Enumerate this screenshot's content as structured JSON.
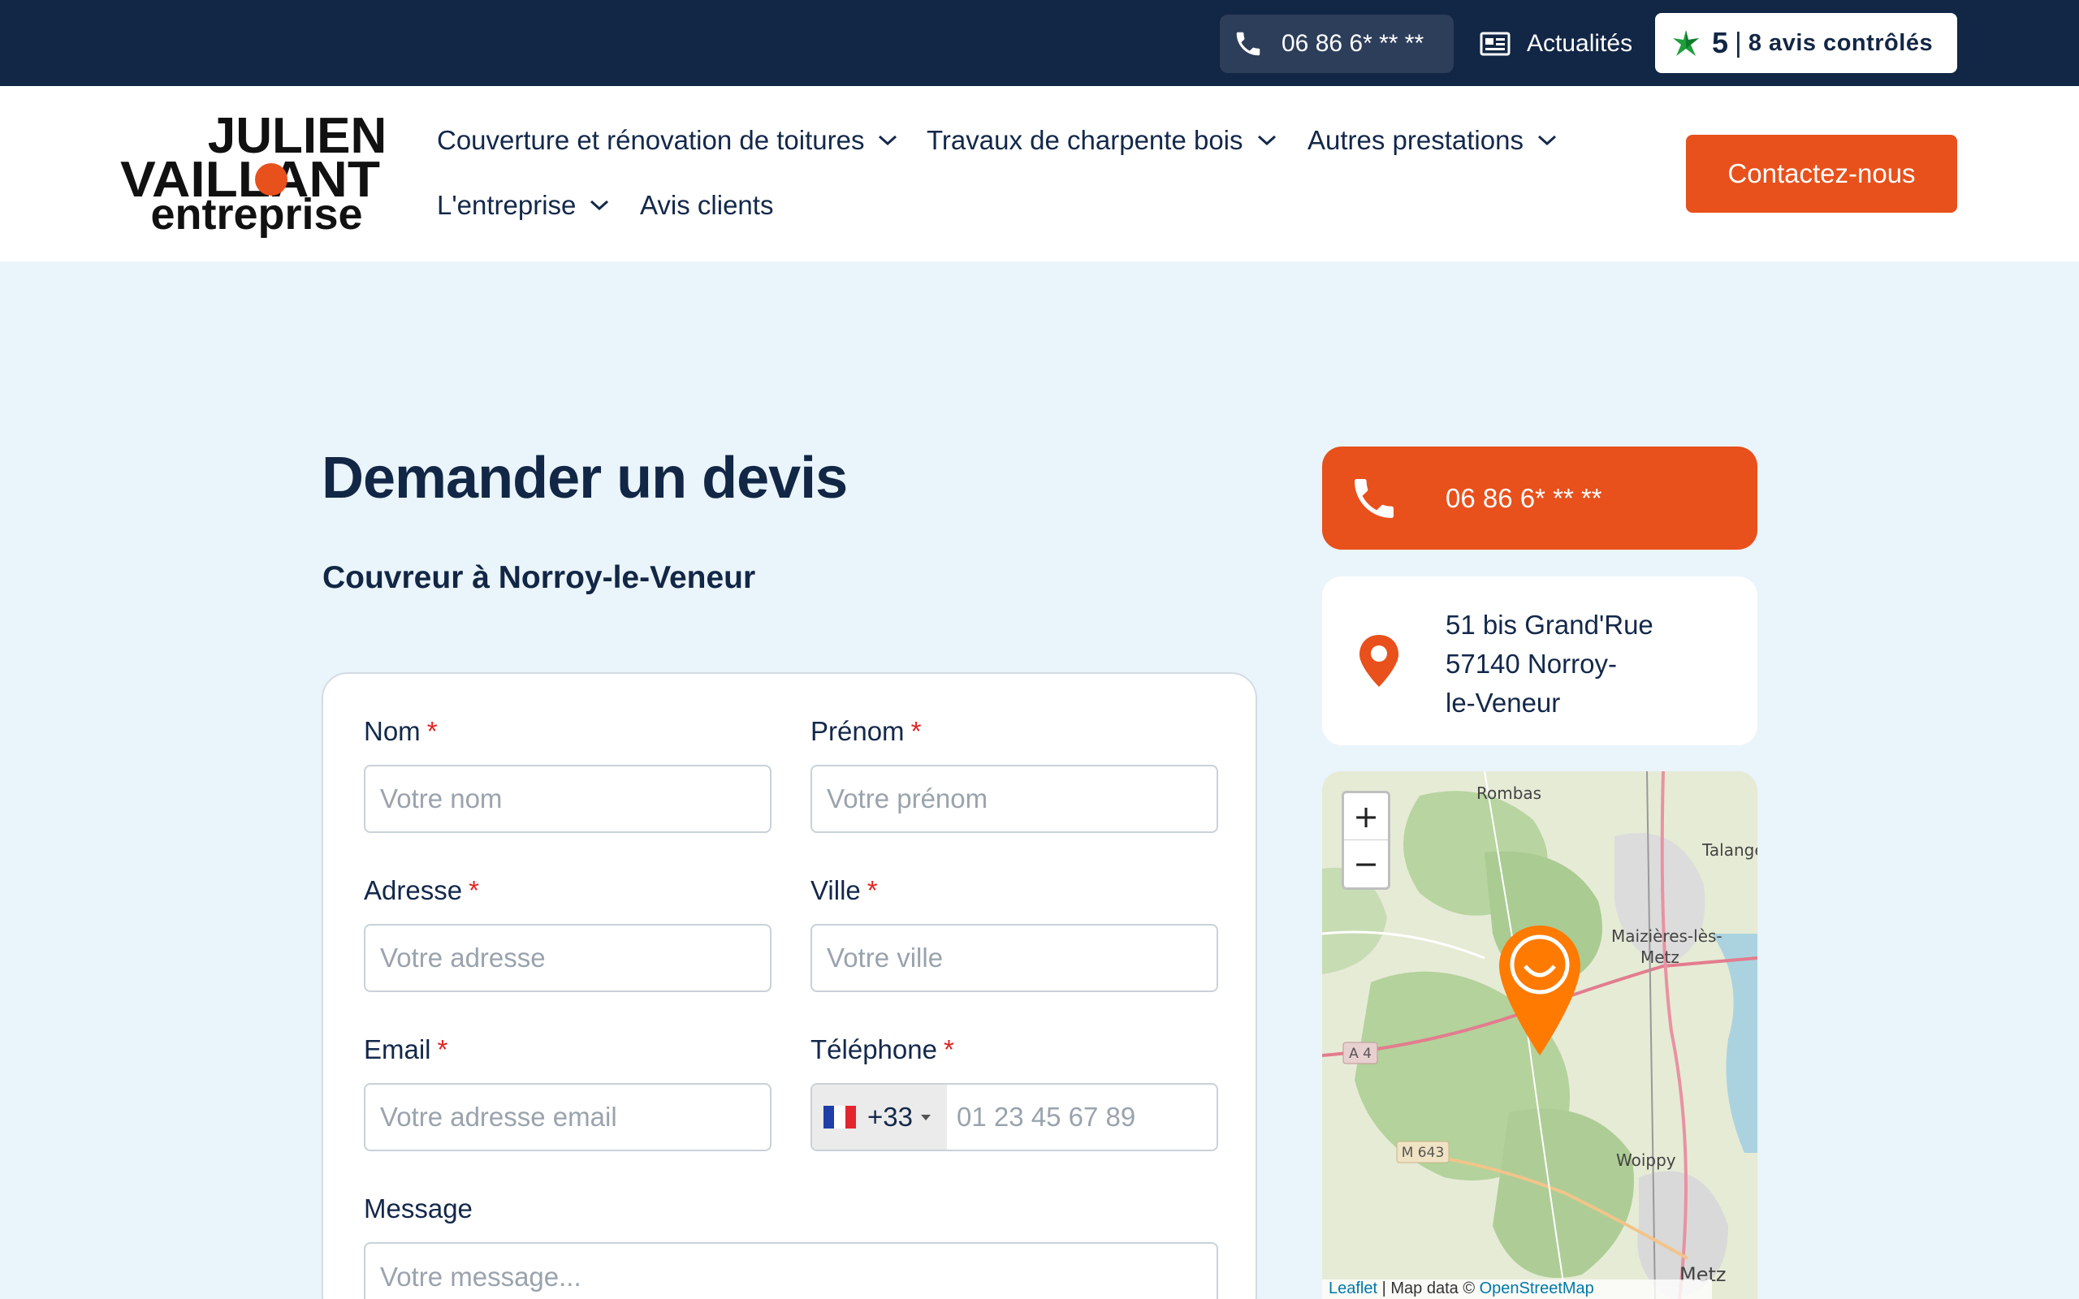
{
  "topbar": {
    "phone": "06 86 6* ** **",
    "news_label": "Actualités",
    "reviews_score": "5",
    "reviews_separator": "|",
    "reviews_text": "8 avis contrôlés"
  },
  "logo": {
    "line1": "JULIEN",
    "line2": "VAILLANT",
    "line3": "entreprise"
  },
  "nav": {
    "items": [
      {
        "label": "Couverture et rénovation de toitures"
      },
      {
        "label": "Travaux de charpente bois"
      },
      {
        "label": "Autres prestations"
      },
      {
        "label": "L'entreprise"
      },
      {
        "label": "Avis clients"
      }
    ],
    "cta_label": "Contactez-nous"
  },
  "main": {
    "title": "Demander un devis",
    "subtitle": "Couvreur à Norroy-le-Veneur"
  },
  "form": {
    "required_mark": "*",
    "nom": {
      "label": "Nom",
      "placeholder": "Votre nom"
    },
    "prenom": {
      "label": "Prénom",
      "placeholder": "Votre prénom"
    },
    "adresse": {
      "label": "Adresse",
      "placeholder": "Votre adresse"
    },
    "ville": {
      "label": "Ville",
      "placeholder": "Votre ville"
    },
    "email": {
      "label": "Email",
      "placeholder": "Votre adresse email"
    },
    "telephone": {
      "label": "Téléphone",
      "dial_code": "+33",
      "placeholder": "01 23 45 67 89"
    },
    "message": {
      "label": "Message",
      "placeholder": "Votre message..."
    }
  },
  "sidebar": {
    "phone": "06 86 6* ** **",
    "address_line1": "51 bis Grand'Rue",
    "address_line2": "57140 Norroy-",
    "address_line3": "le-Veneur"
  },
  "map": {
    "zoom_in": "+",
    "zoom_out": "−",
    "labels": {
      "rombas": "Rombas",
      "talange": "Talange",
      "maizieres1": "Maizières-lès-",
      "maizieres2": "Metz",
      "woippy": "Woippy",
      "metz": "Metz",
      "a4": "A 4",
      "m643": "M 643"
    },
    "attribution_leaflet": "Leaflet",
    "attribution_mid": " | Map data © ",
    "attribution_osm": "OpenStreetMap"
  },
  "colors": {
    "navy": "#122645",
    "orange": "#e8501c",
    "page_bg": "#eaf4fb",
    "required": "#e22222"
  }
}
